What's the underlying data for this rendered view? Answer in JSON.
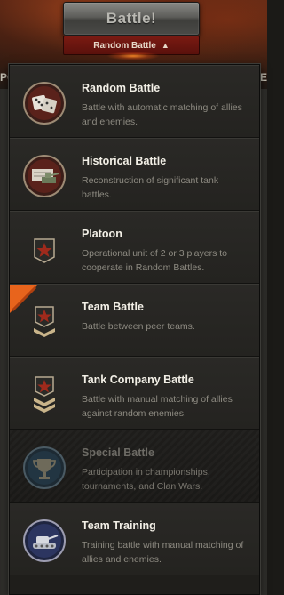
{
  "battle_button": {
    "label": "Battle!"
  },
  "mode_selector": {
    "label": "Random Battle"
  },
  "background": {
    "left_fragment": "PO",
    "right_fragment": "E"
  },
  "menu": {
    "items": [
      {
        "title": "Random Battle",
        "description": "Battle with automatic matching of allies and enemies.",
        "icon": "dice-icon",
        "enabled": true,
        "selected": false
      },
      {
        "title": "Historical Battle",
        "description": "Reconstruction of significant tank battles.",
        "icon": "historical-tank-icon",
        "enabled": true,
        "selected": false
      },
      {
        "title": "Platoon",
        "description": "Operational unit of 2 or 3 players to cooperate in Random Battles.",
        "icon": "star-shield-icon",
        "enabled": true,
        "selected": false
      },
      {
        "title": "Team Battle",
        "description": "Battle between peer teams.",
        "icon": "star-chevron-icon",
        "enabled": true,
        "selected": true
      },
      {
        "title": "Tank Company Battle",
        "description": "Battle with manual matching of allies against random enemies.",
        "icon": "star-double-chevron-icon",
        "enabled": true,
        "selected": false
      },
      {
        "title": "Special Battle",
        "description": "Participation in championships, tournaments, and Clan Wars.",
        "icon": "trophy-icon",
        "enabled": false,
        "selected": false
      },
      {
        "title": "Team Training",
        "description": "Training battle with manual matching of allies and enemies.",
        "icon": "training-tank-icon",
        "enabled": true,
        "selected": false
      }
    ]
  },
  "colors": {
    "accent_red": "#7a1a12",
    "ribbon_orange": "#e8641c",
    "title_white": "#f2efe6",
    "desc_gray": "#8e8b82"
  }
}
